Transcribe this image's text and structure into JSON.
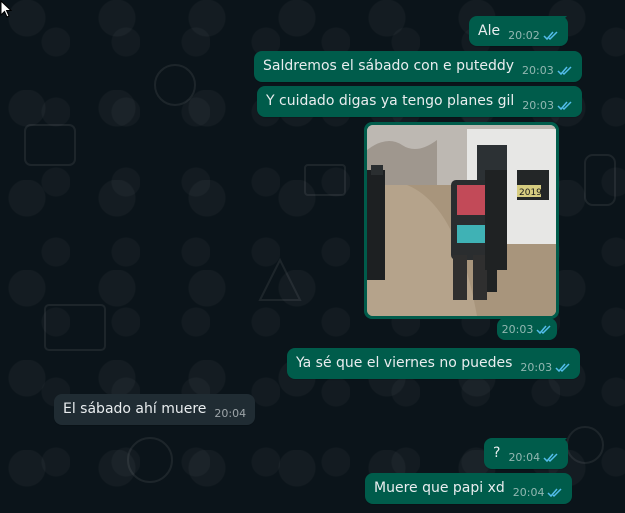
{
  "messages": [
    {
      "text": "Ale",
      "time": "20:02"
    },
    {
      "text": "Saldremos el sábado con e puteddy",
      "time": "20:03"
    },
    {
      "text": "Y cuidado digas ya tengo planes gil",
      "time": "20:03"
    },
    {
      "image_time": "20:03",
      "image_badge": "2019"
    },
    {
      "text": "Ya sé que el viernes no puedes",
      "time": "20:03"
    },
    {
      "text": "El sábado ahí muere",
      "time": "20:04"
    },
    {
      "text": "?",
      "time": "20:04"
    },
    {
      "text": "Muere que papi xd",
      "time": "20:04"
    }
  ],
  "colors": {
    "background": "#0b141a",
    "outgoing_bubble": "#005c4b",
    "incoming_bubble": "#202c33",
    "read_ticks": "#53bdeb"
  },
  "icons": {
    "read_receipt": "double-check-icon",
    "cursor": "mouse-cursor-icon"
  }
}
